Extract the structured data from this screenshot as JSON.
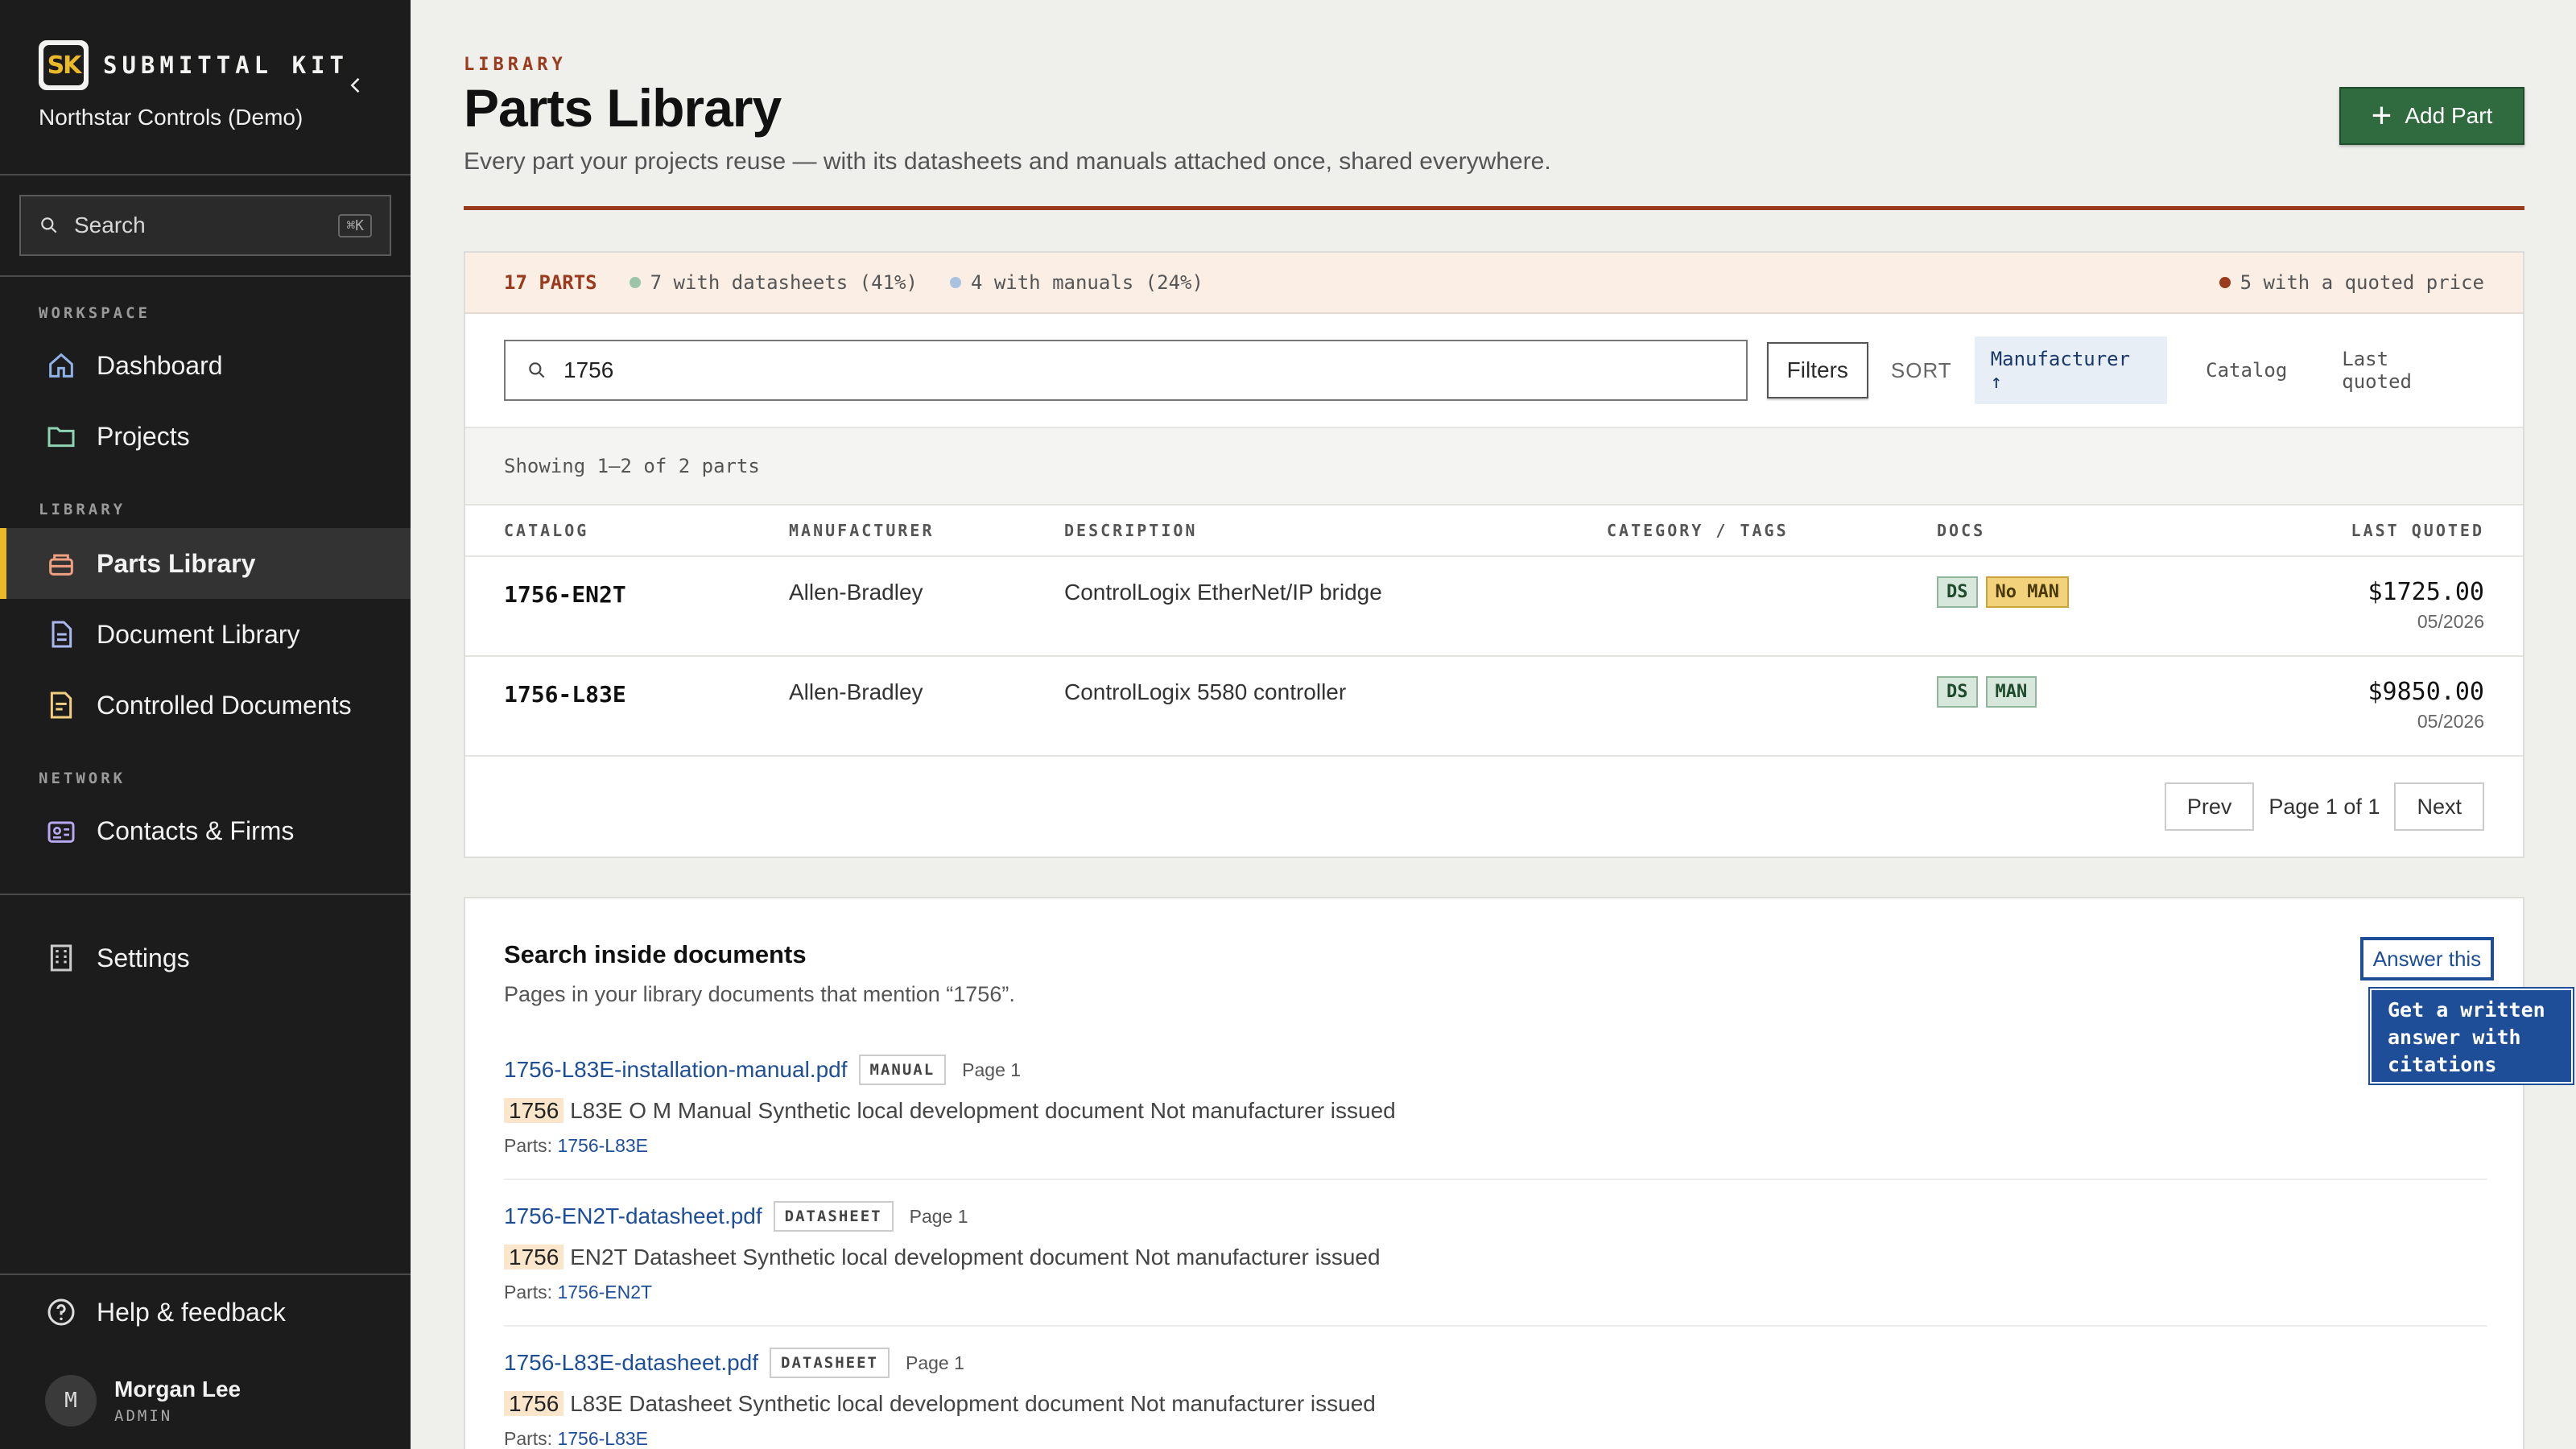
{
  "brand": {
    "logo_text": "SK",
    "name": "SUBMITTAL KIT",
    "org": "Northstar Controls (Demo)"
  },
  "sidebar": {
    "search_label": "Search",
    "search_shortcut": "⌘K",
    "sections": {
      "workspace": "WORKSPACE",
      "library": "LIBRARY",
      "network": "NETWORK"
    },
    "items": [
      {
        "label": "Dashboard"
      },
      {
        "label": "Projects"
      },
      {
        "label": "Parts Library"
      },
      {
        "label": "Document Library"
      },
      {
        "label": "Controlled Documents"
      },
      {
        "label": "Contacts & Firms"
      },
      {
        "label": "Settings"
      }
    ],
    "help": "Help & feedback",
    "user": {
      "initial": "M",
      "name": "Morgan Lee",
      "role": "ADMIN"
    }
  },
  "header": {
    "eyebrow": "LIBRARY",
    "title": "Parts Library",
    "subtitle": "Every part your projects reuse — with its datasheets and manuals attached once, shared everywhere.",
    "add_label": "Add Part"
  },
  "stats": {
    "count": "17 PARTS",
    "datasheets": "7 with datasheets (41%)",
    "manuals": "4 with manuals (24%)",
    "quoted": "5 with a quoted price",
    "colors": {
      "datasheets": "#9cc4a8",
      "manuals": "#a9c2e0",
      "quoted": "#9a3b1e"
    }
  },
  "toolbar": {
    "search_value": "1756",
    "filters_label": "Filters",
    "sort_label": "SORT",
    "sort_options": [
      "Manufacturer ↑",
      "Catalog",
      "Last quoted"
    ]
  },
  "table": {
    "showing": "Showing 1–2 of 2 parts",
    "columns": [
      "CATALOG",
      "MANUFACTURER",
      "DESCRIPTION",
      "CATEGORY / TAGS",
      "DOCS",
      "LAST QUOTED"
    ],
    "rows": [
      {
        "catalog": "1756-EN2T",
        "manufacturer": "Allen-Bradley",
        "description": "ControlLogix EtherNet/IP bridge",
        "docs": [
          "DS",
          "No MAN"
        ],
        "price": "$1725.00",
        "date": "05/2026"
      },
      {
        "catalog": "1756-L83E",
        "manufacturer": "Allen-Bradley",
        "description": "ControlLogix 5580 controller",
        "docs": [
          "DS",
          "MAN"
        ],
        "price": "$9850.00",
        "date": "05/2026"
      }
    ],
    "pager": {
      "prev": "Prev",
      "info": "Page 1 of 1",
      "next": "Next"
    }
  },
  "docs_search": {
    "title": "Search inside documents",
    "subtitle": "Pages in your library documents that mention “1756”.",
    "answer_label": "Answer this",
    "tooltip": "Get a written answer with citations",
    "results": [
      {
        "file": "1756-L83E-installation-manual.pdf",
        "tag": "MANUAL",
        "page": "Page 1",
        "highlight": "1756",
        "snippet": "L83E O M Manual Synthetic local development document Not manufacturer issued",
        "parts_label": "Parts:",
        "part": "1756-L83E"
      },
      {
        "file": "1756-EN2T-datasheet.pdf",
        "tag": "DATASHEET",
        "page": "Page 1",
        "highlight": "1756",
        "snippet": "EN2T Datasheet Synthetic local development document Not manufacturer issued",
        "parts_label": "Parts:",
        "part": "1756-EN2T"
      },
      {
        "file": "1756-L83E-datasheet.pdf",
        "tag": "DATASHEET",
        "page": "Page 1",
        "highlight": "1756",
        "snippet": "L83E Datasheet Synthetic local development document Not manufacturer issued",
        "parts_label": "Parts:",
        "part": "1756-L83E"
      }
    ]
  }
}
